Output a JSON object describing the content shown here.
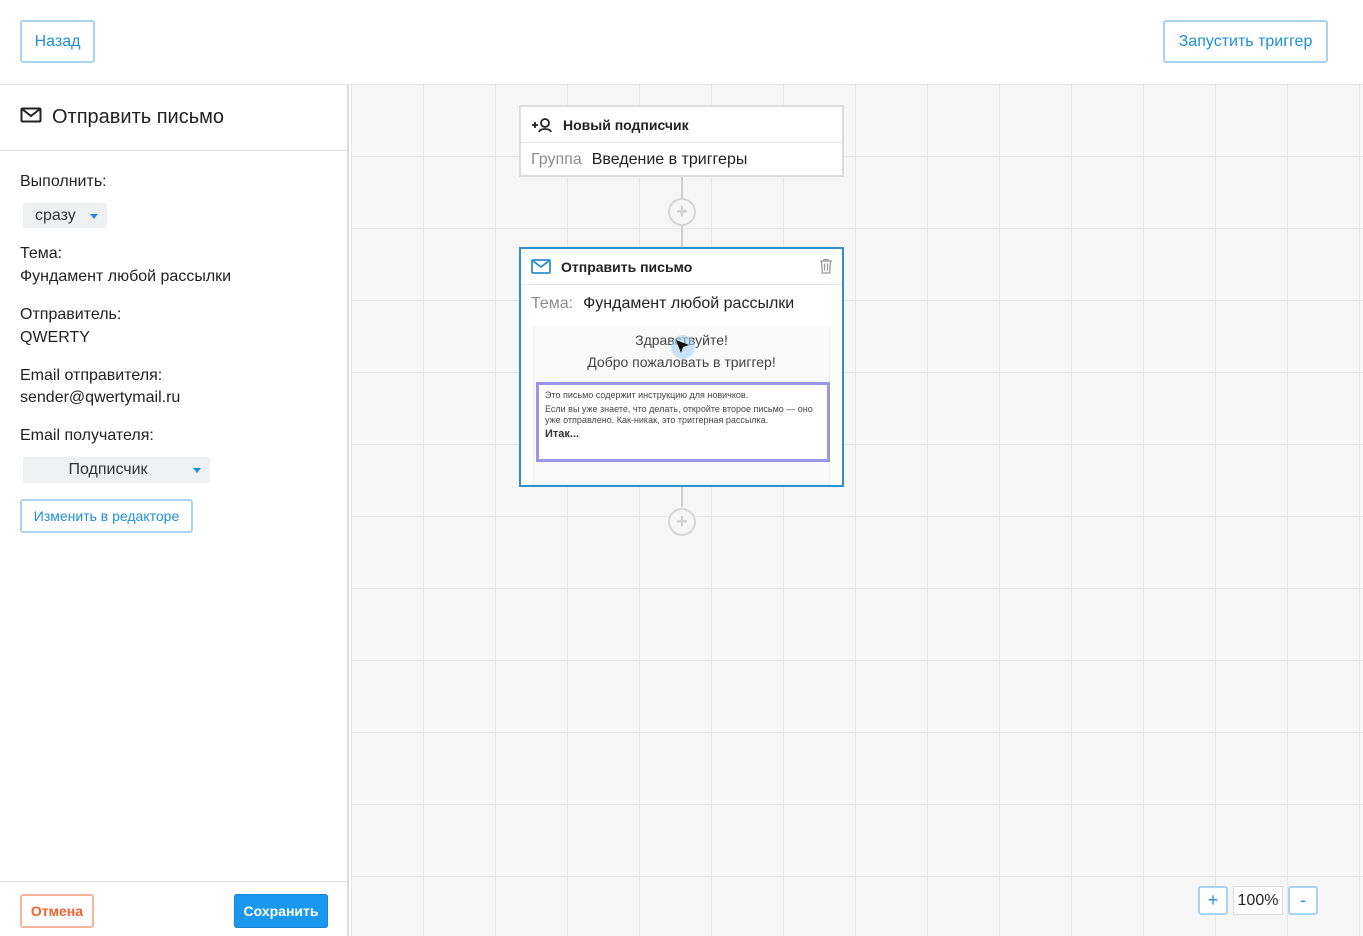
{
  "topbar": {
    "back_label": "Назад",
    "run_label": "Запустить триггер"
  },
  "panel": {
    "title": "Отправить письмо",
    "execute_label": "Выполнить:",
    "execute_value": "сразу",
    "subject_label": "Тема:",
    "subject_value": "Фундамент любой рассылки",
    "sender_label": "Отправитель:",
    "sender_value": "QWERTY",
    "sender_email_label": "Email отправителя:",
    "sender_email_value": "sender@qwertymail.ru",
    "recipient_email_label": "Email получателя:",
    "recipient_email_value": "Подписчик",
    "edit_label": "Изменить в редакторе",
    "cancel_label": "Отмена",
    "save_label": "Сохранить"
  },
  "canvas": {
    "node_trigger": {
      "title": "Новый подписчик",
      "field_label": "Группа",
      "field_value": "Введение в триггеры"
    },
    "node_email": {
      "title": "Отправить письмо",
      "subject_label": "Тема:",
      "subject_value": "Фундамент любой рассылки",
      "preview": {
        "greeting": "Здравствуйте!",
        "welcome": "Добро пожаловать в триггер!",
        "p1": "Это письмо содержит инструкцию для новичков.",
        "p2": "Если вы уже знаете, что делать, откройте второе письмо — оно уже отправлено. Как-никак, это триггерная рассылка.",
        "p3": "Итак..."
      }
    },
    "zoom": {
      "plus_label": "+",
      "value": "100%",
      "minus_label": "-"
    }
  },
  "colors": {
    "accent": "#1e8fd8",
    "save_bg": "#1a98f0",
    "cancel": "#f0612e",
    "selected_node_border": "#2f8fcf",
    "preview_box_border": "#9a97ea"
  },
  "icons": {
    "panel_title": "envelope-icon",
    "trigger_node": "add-user-icon",
    "email_node": "envelope-icon",
    "delete": "trash-icon",
    "add_step": "plus-circle-icon"
  }
}
